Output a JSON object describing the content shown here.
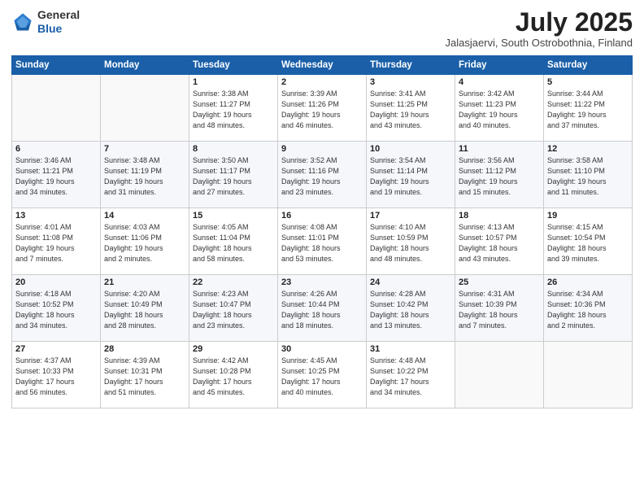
{
  "header": {
    "logo_line1": "General",
    "logo_line2": "Blue",
    "month": "July 2025",
    "location": "Jalasjaervi, South Ostrobothnia, Finland"
  },
  "weekdays": [
    "Sunday",
    "Monday",
    "Tuesday",
    "Wednesday",
    "Thursday",
    "Friday",
    "Saturday"
  ],
  "weeks": [
    [
      {
        "day": "",
        "info": ""
      },
      {
        "day": "",
        "info": ""
      },
      {
        "day": "1",
        "info": "Sunrise: 3:38 AM\nSunset: 11:27 PM\nDaylight: 19 hours\nand 48 minutes."
      },
      {
        "day": "2",
        "info": "Sunrise: 3:39 AM\nSunset: 11:26 PM\nDaylight: 19 hours\nand 46 minutes."
      },
      {
        "day": "3",
        "info": "Sunrise: 3:41 AM\nSunset: 11:25 PM\nDaylight: 19 hours\nand 43 minutes."
      },
      {
        "day": "4",
        "info": "Sunrise: 3:42 AM\nSunset: 11:23 PM\nDaylight: 19 hours\nand 40 minutes."
      },
      {
        "day": "5",
        "info": "Sunrise: 3:44 AM\nSunset: 11:22 PM\nDaylight: 19 hours\nand 37 minutes."
      }
    ],
    [
      {
        "day": "6",
        "info": "Sunrise: 3:46 AM\nSunset: 11:21 PM\nDaylight: 19 hours\nand 34 minutes."
      },
      {
        "day": "7",
        "info": "Sunrise: 3:48 AM\nSunset: 11:19 PM\nDaylight: 19 hours\nand 31 minutes."
      },
      {
        "day": "8",
        "info": "Sunrise: 3:50 AM\nSunset: 11:17 PM\nDaylight: 19 hours\nand 27 minutes."
      },
      {
        "day": "9",
        "info": "Sunrise: 3:52 AM\nSunset: 11:16 PM\nDaylight: 19 hours\nand 23 minutes."
      },
      {
        "day": "10",
        "info": "Sunrise: 3:54 AM\nSunset: 11:14 PM\nDaylight: 19 hours\nand 19 minutes."
      },
      {
        "day": "11",
        "info": "Sunrise: 3:56 AM\nSunset: 11:12 PM\nDaylight: 19 hours\nand 15 minutes."
      },
      {
        "day": "12",
        "info": "Sunrise: 3:58 AM\nSunset: 11:10 PM\nDaylight: 19 hours\nand 11 minutes."
      }
    ],
    [
      {
        "day": "13",
        "info": "Sunrise: 4:01 AM\nSunset: 11:08 PM\nDaylight: 19 hours\nand 7 minutes."
      },
      {
        "day": "14",
        "info": "Sunrise: 4:03 AM\nSunset: 11:06 PM\nDaylight: 19 hours\nand 2 minutes."
      },
      {
        "day": "15",
        "info": "Sunrise: 4:05 AM\nSunset: 11:04 PM\nDaylight: 18 hours\nand 58 minutes."
      },
      {
        "day": "16",
        "info": "Sunrise: 4:08 AM\nSunset: 11:01 PM\nDaylight: 18 hours\nand 53 minutes."
      },
      {
        "day": "17",
        "info": "Sunrise: 4:10 AM\nSunset: 10:59 PM\nDaylight: 18 hours\nand 48 minutes."
      },
      {
        "day": "18",
        "info": "Sunrise: 4:13 AM\nSunset: 10:57 PM\nDaylight: 18 hours\nand 43 minutes."
      },
      {
        "day": "19",
        "info": "Sunrise: 4:15 AM\nSunset: 10:54 PM\nDaylight: 18 hours\nand 39 minutes."
      }
    ],
    [
      {
        "day": "20",
        "info": "Sunrise: 4:18 AM\nSunset: 10:52 PM\nDaylight: 18 hours\nand 34 minutes."
      },
      {
        "day": "21",
        "info": "Sunrise: 4:20 AM\nSunset: 10:49 PM\nDaylight: 18 hours\nand 28 minutes."
      },
      {
        "day": "22",
        "info": "Sunrise: 4:23 AM\nSunset: 10:47 PM\nDaylight: 18 hours\nand 23 minutes."
      },
      {
        "day": "23",
        "info": "Sunrise: 4:26 AM\nSunset: 10:44 PM\nDaylight: 18 hours\nand 18 minutes."
      },
      {
        "day": "24",
        "info": "Sunrise: 4:28 AM\nSunset: 10:42 PM\nDaylight: 18 hours\nand 13 minutes."
      },
      {
        "day": "25",
        "info": "Sunrise: 4:31 AM\nSunset: 10:39 PM\nDaylight: 18 hours\nand 7 minutes."
      },
      {
        "day": "26",
        "info": "Sunrise: 4:34 AM\nSunset: 10:36 PM\nDaylight: 18 hours\nand 2 minutes."
      }
    ],
    [
      {
        "day": "27",
        "info": "Sunrise: 4:37 AM\nSunset: 10:33 PM\nDaylight: 17 hours\nand 56 minutes."
      },
      {
        "day": "28",
        "info": "Sunrise: 4:39 AM\nSunset: 10:31 PM\nDaylight: 17 hours\nand 51 minutes."
      },
      {
        "day": "29",
        "info": "Sunrise: 4:42 AM\nSunset: 10:28 PM\nDaylight: 17 hours\nand 45 minutes."
      },
      {
        "day": "30",
        "info": "Sunrise: 4:45 AM\nSunset: 10:25 PM\nDaylight: 17 hours\nand 40 minutes."
      },
      {
        "day": "31",
        "info": "Sunrise: 4:48 AM\nSunset: 10:22 PM\nDaylight: 17 hours\nand 34 minutes."
      },
      {
        "day": "",
        "info": ""
      },
      {
        "day": "",
        "info": ""
      }
    ]
  ]
}
